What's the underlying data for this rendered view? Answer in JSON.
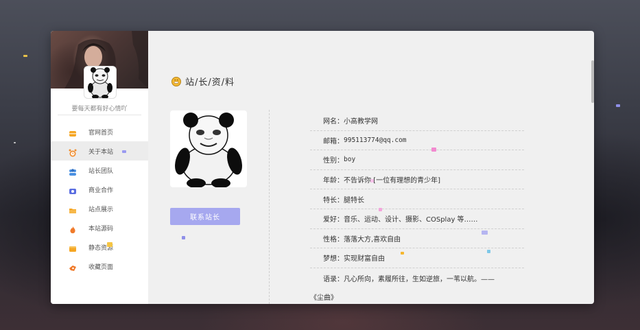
{
  "sidebar": {
    "motto": "要每天都有好心情吖",
    "items": [
      {
        "label": "官网首页",
        "icon": "home-icon",
        "color": "#f5a623"
      },
      {
        "label": "关于本站",
        "icon": "alarm-clock-icon",
        "color": "#f08c2c"
      },
      {
        "label": "站长团队",
        "icon": "team-icon",
        "color": "#4a90e2"
      },
      {
        "label": "商业合作",
        "icon": "handshake-icon",
        "color": "#5b6ee1"
      },
      {
        "label": "站点展示",
        "icon": "folder-icon",
        "color": "#f5a623"
      },
      {
        "label": "本站源码",
        "icon": "flame-icon",
        "color": "#f07a2a"
      },
      {
        "label": "静态资源",
        "icon": "package-icon",
        "color": "#f5a623"
      },
      {
        "label": "收藏页面",
        "icon": "bookmark-icon",
        "color": "#f07a2a"
      }
    ],
    "active_index": 1
  },
  "main": {
    "title": "站/长/资/料",
    "contact_button": "联系站长",
    "info": [
      {
        "key": "网名：",
        "value": "小高教学网"
      },
      {
        "key": "邮箱：",
        "value": "995113774@qq.com"
      },
      {
        "key": "性别：",
        "value": "boy"
      },
      {
        "key": "年龄：",
        "value": "不告诉你 [一位有理想的青少年]"
      },
      {
        "key": "特长：",
        "value": "腿特长"
      },
      {
        "key": "爱好：",
        "value": "音乐、运动、设计、摄影、COSplay 等……"
      },
      {
        "key": "性格：",
        "value": "落落大方,喜欢自由"
      },
      {
        "key": "梦想：",
        "value": "实现财富自由"
      },
      {
        "key": "语录：",
        "value": "凡心所向，素履所往，生如逆旅，一苇以航。——"
      }
    ],
    "signoff": "《尘曲》"
  },
  "colors": {
    "button": "#a6a8ef",
    "active_nav": "#ececec"
  }
}
